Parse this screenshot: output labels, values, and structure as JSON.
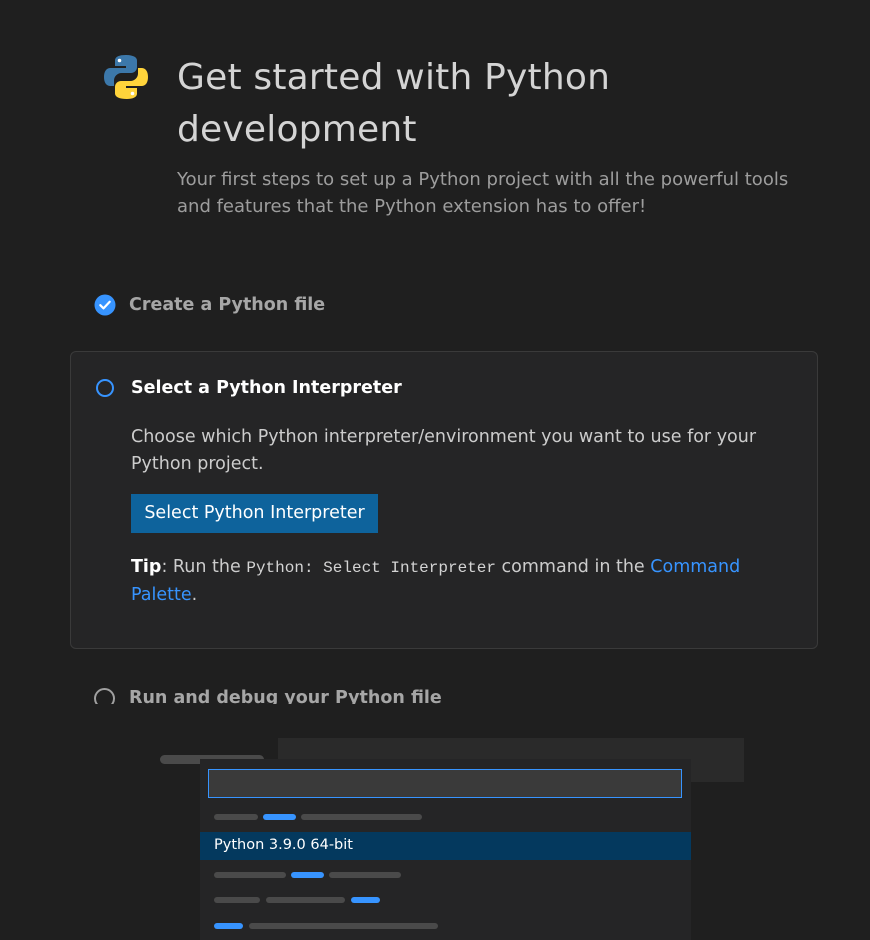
{
  "header": {
    "title": "Get started with Python development",
    "subtitle": "Your first steps to set up a Python project with all the powerful tools and features that the Python extension has to offer!"
  },
  "steps": [
    {
      "label": "Create a Python file",
      "status": "completed"
    },
    {
      "label": "Select a Python Interpreter",
      "status": "active",
      "description": "Choose which Python interpreter/environment you want to use for your Python project.",
      "button_label": "Select Python Interpreter",
      "tip": {
        "label": "Tip",
        "text_before": ": Run the ",
        "command": "Python: Select Interpreter",
        "text_middle": " command in the ",
        "link": "Command Palette",
        "text_after": "."
      }
    },
    {
      "label": "Run and debug your Python file",
      "status": "pending"
    }
  ],
  "media": {
    "selected_item": "Python 3.9.0 64-bit"
  },
  "colors": {
    "accent": "#3794ff",
    "button": "#0e639c",
    "background": "#1f1f1f",
    "selected_row": "#04395e"
  },
  "icons": {
    "logo": "python-logo-icon",
    "completed": "check-circle-icon",
    "active": "radio-circle-icon"
  }
}
